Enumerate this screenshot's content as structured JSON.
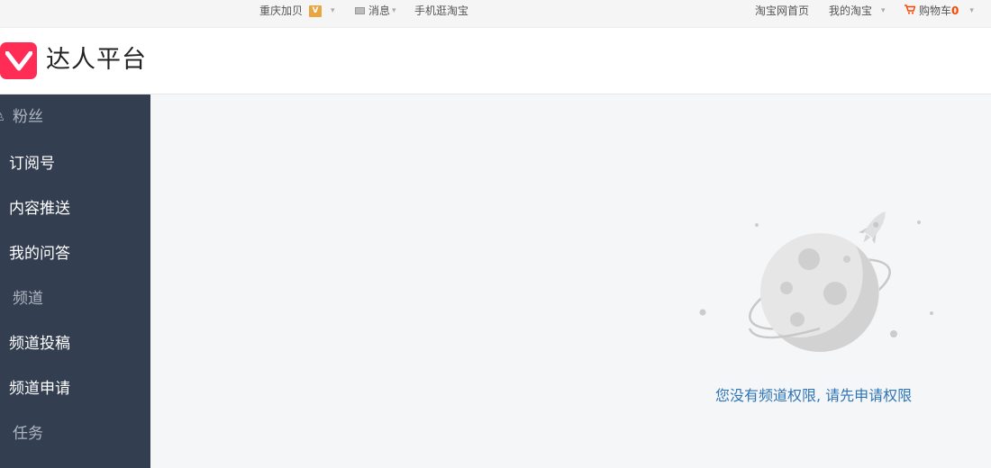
{
  "topbar": {
    "location": "重庆加贝",
    "vip_badge": "V",
    "messages": "消息",
    "mobile": "手机逛淘宝",
    "home": "淘宝网首页",
    "my_taobao": "我的淘宝",
    "cart": "购物车",
    "cart_count": "0"
  },
  "header": {
    "title": "达人平台",
    "brand_color": "#ff2d55"
  },
  "sidebar": {
    "items": [
      {
        "label": "粉丝",
        "type": "group"
      },
      {
        "label": "订阅号",
        "type": "link"
      },
      {
        "label": "内容推送",
        "type": "link"
      },
      {
        "label": "我的问答",
        "type": "link"
      },
      {
        "label": "频道",
        "type": "group"
      },
      {
        "label": "频道投稿",
        "type": "link"
      },
      {
        "label": "频道申请",
        "type": "link"
      },
      {
        "label": "任务",
        "type": "group"
      }
    ]
  },
  "main": {
    "empty_message": "您没有频道权限, 请先申请权限",
    "illustration": "moon-rocket-illustration"
  }
}
